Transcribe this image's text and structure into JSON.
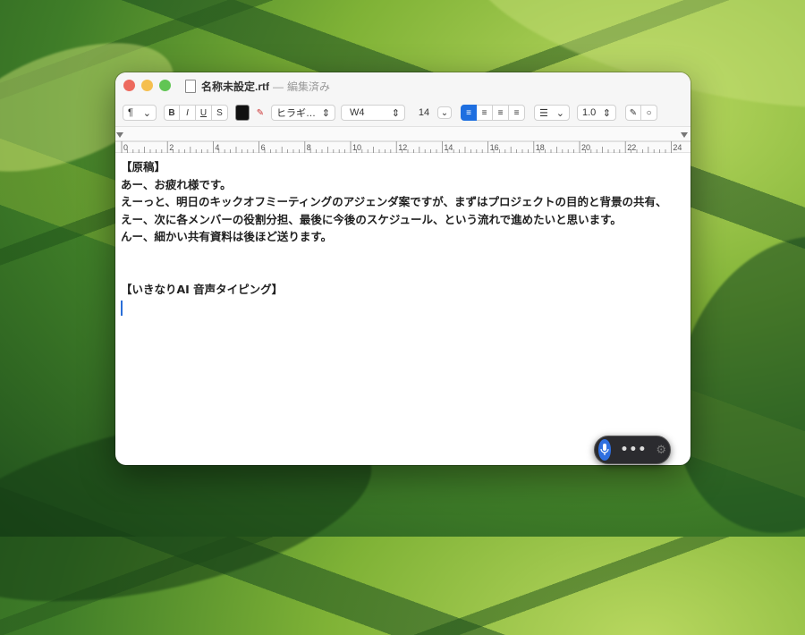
{
  "window": {
    "title": "名称未設定.rtf",
    "separator": "—",
    "status": "編集済み"
  },
  "toolbar": {
    "paragraph_style": "¶",
    "bold": "B",
    "italic": "I",
    "underline": "U",
    "strikethrough": "S",
    "text_color": "#111111",
    "font_family": "ヒラギ…",
    "font_weight": "W4",
    "font_size": "14",
    "line_spacing": "1.0",
    "icons": [
      "highlight-off-icon",
      "align-left-icon",
      "align-center-icon",
      "align-right-icon",
      "align-justify-icon",
      "list-icon",
      "pencil-icon",
      "circle-icon"
    ]
  },
  "ruler": {
    "labels": [
      "0",
      "2",
      "4",
      "6",
      "8",
      "10",
      "12",
      "14",
      "16",
      "18",
      "20",
      "22",
      "24"
    ]
  },
  "document": {
    "lines": [
      "【原稿】",
      "あー、お疲れ様です。",
      "えーっと、明日のキックオフミーティングのアジェンダ案ですが、まずはプロジェクトの目的と背景の共有、",
      "えー、次に各メンバーの役割分担、最後に今後のスケジュール、という流れで進めたいと思います。",
      "んー、細かい共有資料は後ほど送ります。",
      "",
      "",
      "【いきなりAI 音声タイピング】"
    ]
  },
  "dictation": {
    "more": "•••",
    "icons": [
      "microphone-icon",
      "more-icon",
      "gear-icon"
    ]
  },
  "colors": {
    "accent": "#1e6fe0",
    "close": "#ed6a5e",
    "minimize": "#f5bf4f",
    "maximize": "#61c554"
  }
}
